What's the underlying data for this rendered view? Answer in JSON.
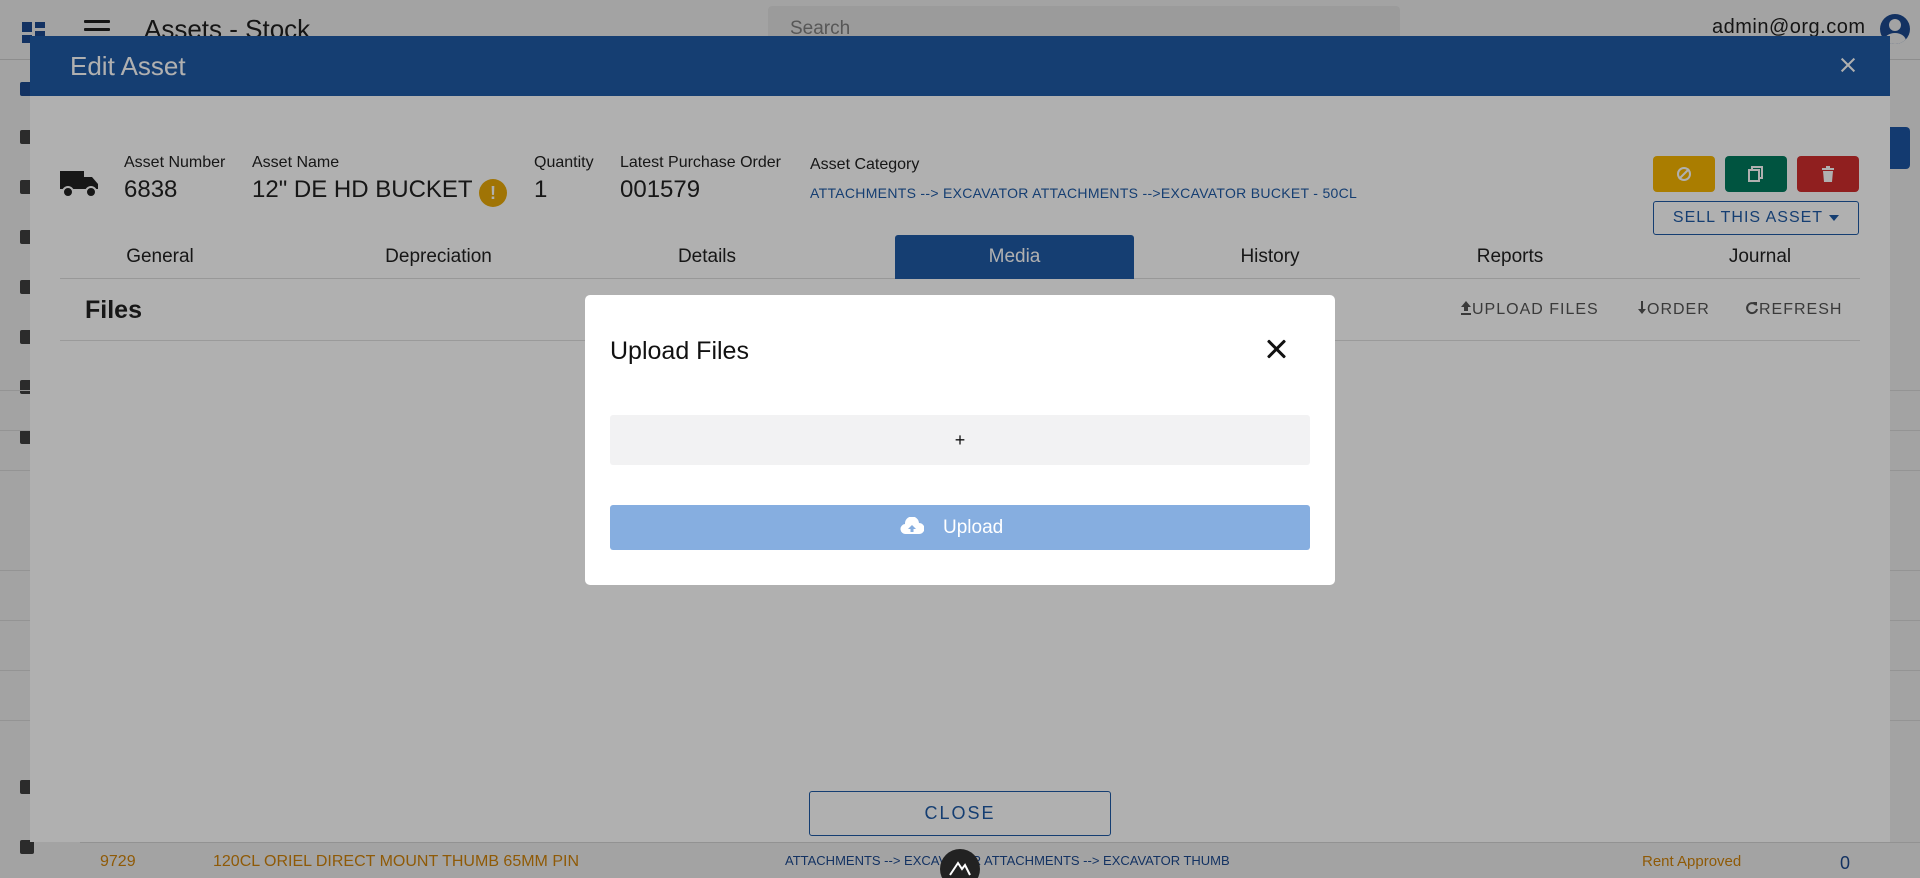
{
  "app": {
    "title": "Assets - Stock",
    "search_placeholder": "Search",
    "user": "admin@org.com"
  },
  "background_row": {
    "number": "9729",
    "name": "120CL ORIEL DIRECT MOUNT THUMB 65MM PIN",
    "category": "ATTACHMENTS --> EXCAVATOR ATTACHMENTS --> EXCAVATOR THUMB",
    "status": "Rent Approved",
    "qty": "0"
  },
  "dialog": {
    "title": "Edit Asset",
    "asset_number_label": "Asset Number",
    "asset_number": "6838",
    "asset_name_label": "Asset Name",
    "asset_name": "12\" DE HD BUCKET",
    "warning_glyph": "!",
    "quantity_label": "Quantity",
    "quantity": "1",
    "po_label": "Latest Purchase Order",
    "po_number": "001579",
    "category_label": "Asset Category",
    "category_path": "ATTACHMENTS --> EXCAVATOR ATTACHMENTS -->EXCAVATOR BUCKET - 50CL",
    "sell_button": "SELL THIS ASSET",
    "tabs": [
      {
        "label": "General"
      },
      {
        "label": "Depreciation"
      },
      {
        "label": "Details"
      },
      {
        "label": "Media"
      },
      {
        "label": "History"
      },
      {
        "label": "Reports"
      },
      {
        "label": "Journal"
      }
    ],
    "active_tab": "Media",
    "files_title": "Files",
    "upload_files_action": "UPLOAD FILES",
    "order_action": "ORDER",
    "refresh_action": "REFRESH",
    "close_button": "CLOSE"
  },
  "upload_modal": {
    "title": "Upload Files",
    "add_glyph": "+",
    "upload_button": "Upload"
  },
  "colors": {
    "primary": "#1f5aa5",
    "warning": "#e8a908",
    "action_yellow": "#f6b600",
    "action_green": "#007a5e",
    "action_red": "#d12d2d",
    "upload_disabled": "#86aee0",
    "background_link": "#e08e0b"
  },
  "icons": [
    "truck-icon",
    "warning-icon",
    "unlink-icon",
    "copy-icon",
    "trash-icon",
    "upload-icon",
    "arrow-down-icon",
    "refresh-icon",
    "cloud-upload-icon",
    "close-icon",
    "menu-icon",
    "user-icon"
  ]
}
